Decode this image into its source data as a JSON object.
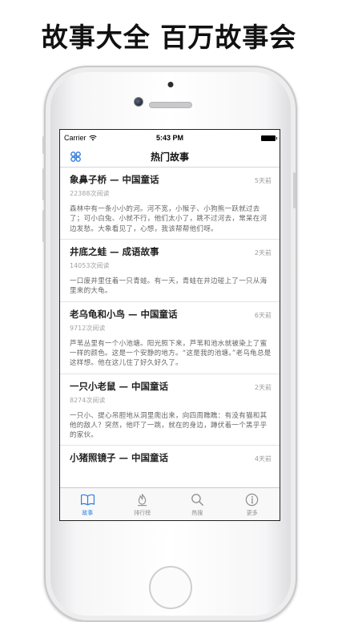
{
  "banner": {
    "headline": "故事大全 百万故事会"
  },
  "status_bar": {
    "carrier": "Carrier",
    "time": "5:43 PM"
  },
  "nav": {
    "title": "热门故事",
    "menu_icon": "grid-menu-icon"
  },
  "stories": [
    {
      "title": "象鼻子桥 — 中国童话",
      "date": "5天前",
      "reads": "22388次阅读",
      "excerpt": "森林中有一条小小的河。河不宽，小猴子、小狗熊一跃就过去了；可小白兔、小就不行，他们太小了，跳不过河去，常呆在河边发愁。大象看见了，心想，我该帮帮他们呀。"
    },
    {
      "title": "井底之蛙 — 成语故事",
      "date": "2天前",
      "reads": "14053次阅读",
      "excerpt": "一口废井里住着一只青蛙。有一天，青蛙在井边碰上了一只从海里来的大龟。"
    },
    {
      "title": "老乌龟和小鸟 — 中国童话",
      "date": "6天前",
      "reads": "9712次阅读",
      "excerpt": "芦苇丛里有一个小池塘。阳光照下来，芦苇和池水就被染上了蜜一样的颜色。这是一个安静的地方。“这是我的池塘。”老乌龟总是这样想。他在这儿住了好久好久了。"
    },
    {
      "title": "一只小老鼠 — 中国童话",
      "date": "2天前",
      "reads": "8274次阅读",
      "excerpt": "一只小、提心吊胆地从洞里爬出来，向四周瞧瞧：有没有猫和其他的敌人？突然，他吓了一跳，就在的身边，蹲伏着一个黑乎乎的家伙。"
    },
    {
      "title": "小猪照镜子 — 中国童话",
      "date": "4天前",
      "reads": "",
      "excerpt": ""
    }
  ],
  "tabs": [
    {
      "label": "故事",
      "icon": "book-icon",
      "active": true
    },
    {
      "label": "排行榜",
      "icon": "flame-icon",
      "active": false
    },
    {
      "label": "热搜",
      "icon": "search-icon",
      "active": false
    },
    {
      "label": "更多",
      "icon": "info-icon",
      "active": false
    }
  ],
  "colors": {
    "accent": "#2f7ee0",
    "inactive": "#8e8e8e"
  }
}
